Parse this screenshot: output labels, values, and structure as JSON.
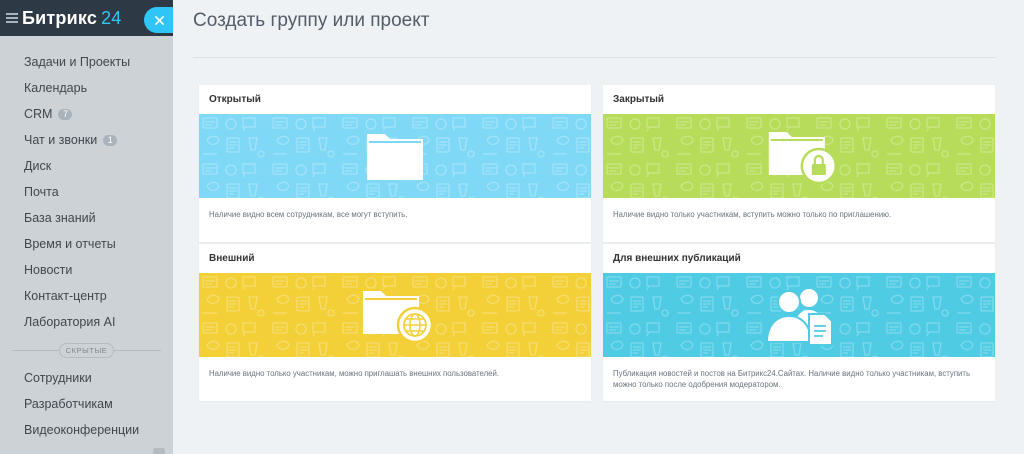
{
  "sidebar": {
    "logo_text": "Битрикс",
    "logo_number": "24",
    "items": [
      {
        "label": "Задачи и Проекты"
      },
      {
        "label": "Календарь"
      },
      {
        "label": "CRM",
        "counter": "7"
      },
      {
        "label": "Чат и звонки",
        "counter": "1"
      },
      {
        "label": "Диск"
      },
      {
        "label": "Почта"
      },
      {
        "label": "База знаний"
      },
      {
        "label": "Время и отчеты"
      },
      {
        "label": "Новости"
      },
      {
        "label": "Контакт-центр"
      },
      {
        "label": "Лаборатория AI"
      }
    ],
    "hidden_label": "СКРЫТЫЕ",
    "hidden_items": [
      {
        "label": "Сотрудники"
      },
      {
        "label": "Разработчикам"
      },
      {
        "label": "Видеоконференции"
      }
    ]
  },
  "page": {
    "title": "Создать группу или проект"
  },
  "cards": {
    "open": {
      "title": "Открытый",
      "description": "Наличие видно всем сотрудникам, все могут вступить.",
      "color": "#7fd8f6",
      "icon": "folder-icon"
    },
    "closed": {
      "title": "Закрытый",
      "description": "Наличие видно только участникам, вступить можно только по приглашению.",
      "color": "#b7dc5a",
      "icon": "lock-folder-icon"
    },
    "external": {
      "title": "Внешний",
      "description": "Наличие видно только участникам, можно приглашать внешних пользователей.",
      "color": "#f3d038",
      "icon": "globe-folder-icon"
    },
    "publications": {
      "title": "Для внешних публикаций",
      "description": "Публикация новостей и постов на Битрикс24.Сайтах. Наличие видно только участникам, вступить можно только после одобрения модератором.",
      "color": "#4fcbe4",
      "icon": "users-document-icon"
    }
  },
  "colors": {
    "sidebar_bg": "#ccd2d6",
    "header_bg": "#2d3a45",
    "accent": "#2fc6f6"
  }
}
